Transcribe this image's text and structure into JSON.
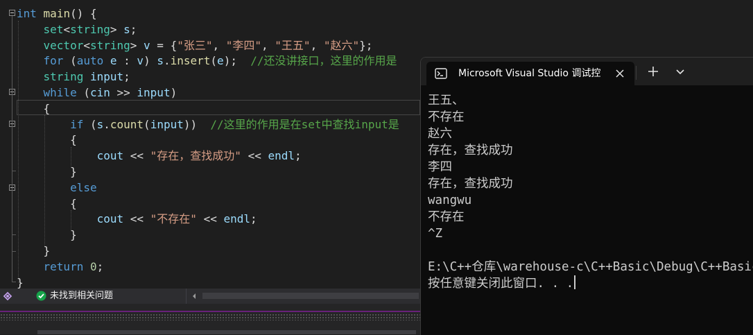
{
  "editor": {
    "lines": [
      [
        [
          "kw",
          "int"
        ],
        [
          "t",
          " "
        ],
        [
          "fn",
          "main"
        ],
        [
          "t",
          "() {"
        ]
      ],
      [
        [
          "t",
          "    "
        ],
        [
          "ty",
          "set"
        ],
        [
          "t",
          "<"
        ],
        [
          "ty",
          "string"
        ],
        [
          "t",
          "> "
        ],
        [
          "var",
          "s"
        ],
        [
          "t",
          ";"
        ]
      ],
      [
        [
          "t",
          "    "
        ],
        [
          "ty",
          "vector"
        ],
        [
          "t",
          "<"
        ],
        [
          "ty",
          "string"
        ],
        [
          "t",
          "> "
        ],
        [
          "var",
          "v"
        ],
        [
          "t",
          " = {"
        ],
        [
          "str",
          "\"张三\""
        ],
        [
          "t",
          ", "
        ],
        [
          "str",
          "\"李四\""
        ],
        [
          "t",
          ", "
        ],
        [
          "str",
          "\"王五\""
        ],
        [
          "t",
          ", "
        ],
        [
          "str",
          "\"赵六\""
        ],
        [
          "t",
          "};"
        ]
      ],
      [
        [
          "t",
          "    "
        ],
        [
          "kw",
          "for"
        ],
        [
          "t",
          " ("
        ],
        [
          "kw",
          "auto"
        ],
        [
          "t",
          " "
        ],
        [
          "var",
          "e"
        ],
        [
          "t",
          " : "
        ],
        [
          "var",
          "v"
        ],
        [
          "t",
          ") "
        ],
        [
          "var",
          "s"
        ],
        [
          "t",
          "."
        ],
        [
          "fn",
          "insert"
        ],
        [
          "t",
          "("
        ],
        [
          "var",
          "e"
        ],
        [
          "t",
          ");  "
        ],
        [
          "cmt",
          "//还没讲接口，这里的作用是"
        ]
      ],
      [
        [
          "t",
          "    "
        ],
        [
          "ty",
          "string"
        ],
        [
          "t",
          " "
        ],
        [
          "var",
          "input"
        ],
        [
          "t",
          ";"
        ]
      ],
      [
        [
          "t",
          "    "
        ],
        [
          "kw",
          "while"
        ],
        [
          "t",
          " ("
        ],
        [
          "var",
          "cin"
        ],
        [
          "t",
          " >> "
        ],
        [
          "var",
          "input"
        ],
        [
          "t",
          ")"
        ]
      ],
      [
        [
          "t",
          "    {"
        ]
      ],
      [
        [
          "t",
          "        "
        ],
        [
          "kw",
          "if"
        ],
        [
          "t",
          " ("
        ],
        [
          "var",
          "s"
        ],
        [
          "t",
          "."
        ],
        [
          "fn",
          "count"
        ],
        [
          "t",
          "("
        ],
        [
          "var",
          "input"
        ],
        [
          "t",
          "))  "
        ],
        [
          "cmt",
          "//这里的作用是在set中查找input是"
        ]
      ],
      [
        [
          "t",
          "        {"
        ]
      ],
      [
        [
          "t",
          "            "
        ],
        [
          "var",
          "cout"
        ],
        [
          "t",
          " << "
        ],
        [
          "str",
          "\"存在，查找成功\""
        ],
        [
          "t",
          " << "
        ],
        [
          "var",
          "endl"
        ],
        [
          "t",
          ";"
        ]
      ],
      [
        [
          "t",
          "        }"
        ]
      ],
      [
        [
          "t",
          "        "
        ],
        [
          "kw",
          "else"
        ]
      ],
      [
        [
          "t",
          "        {"
        ]
      ],
      [
        [
          "t",
          "            "
        ],
        [
          "var",
          "cout"
        ],
        [
          "t",
          " << "
        ],
        [
          "str",
          "\"不存在\""
        ],
        [
          "t",
          " << "
        ],
        [
          "var",
          "endl"
        ],
        [
          "t",
          ";"
        ]
      ],
      [
        [
          "t",
          "        }"
        ]
      ],
      [
        [
          "t",
          "    }"
        ]
      ],
      [
        [
          "t",
          "    "
        ],
        [
          "kw",
          "return"
        ],
        [
          "t",
          " "
        ],
        [
          "num",
          "0"
        ],
        [
          "t",
          ";"
        ]
      ],
      [
        [
          "t",
          "}"
        ]
      ]
    ]
  },
  "status": {
    "issues_text": "未找到相关问题"
  },
  "terminal": {
    "tab_title": "Microsoft Visual Studio 调试控",
    "output_lines": [
      "王五、",
      "不存在",
      "赵六",
      "存在，查找成功",
      "李四",
      "存在，查找成功",
      "wangwu",
      "不存在",
      "^Z",
      "",
      "E:\\C++仓库\\warehouse-c\\C++Basic\\Debug\\C++Basic.exe",
      "按任意键关闭此窗口. . ."
    ]
  },
  "colors": {
    "editor_bg": "#1e1e1e",
    "keyword": "#569cd6",
    "type": "#4ec9b0",
    "string": "#d69d85",
    "comment": "#57a64a",
    "function": "#dcdcaa",
    "variable": "#9cdcfe",
    "terminal_bg": "#0c0c0c",
    "accent": "#68217a",
    "success_green": "#16a34a"
  },
  "icons": {
    "status_left": "vs-icon",
    "status_issue": "check-circle-icon",
    "status_scroll": "scroll-left-icon",
    "tab_icon": "console-icon",
    "tab_close": "close-icon",
    "new_tab": "plus-icon",
    "dropdown": "chevron-down-icon"
  }
}
